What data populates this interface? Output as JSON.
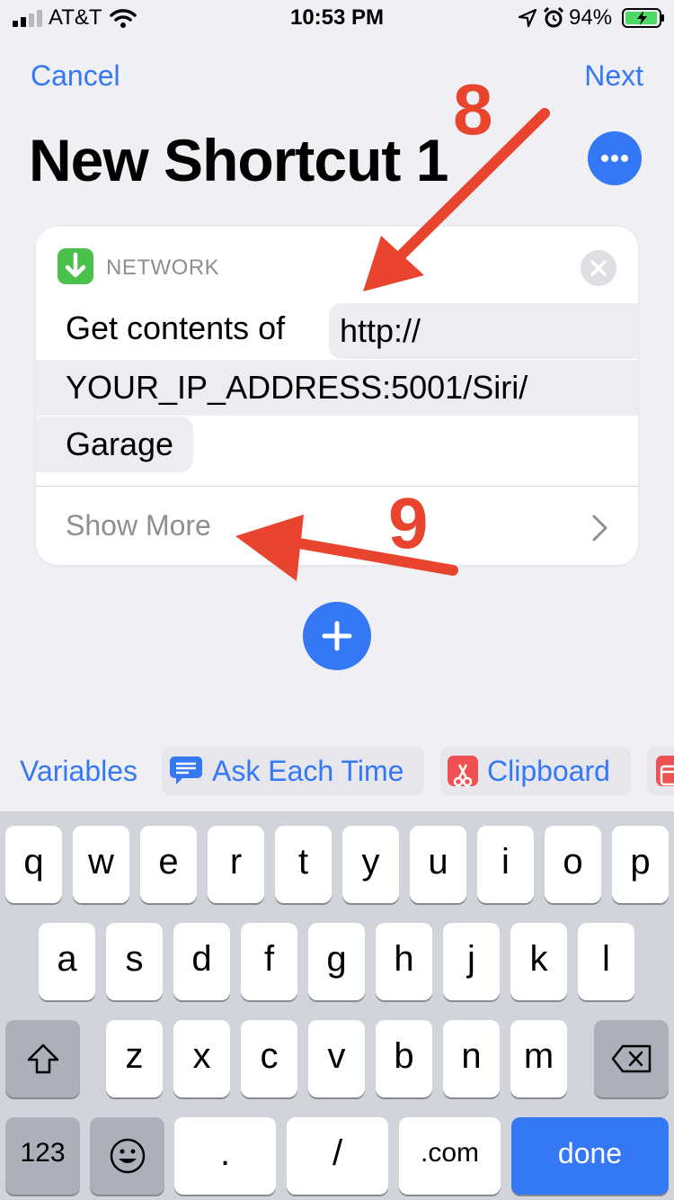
{
  "status_bar": {
    "carrier": "AT&T",
    "time": "10:53 PM",
    "battery": "94%"
  },
  "nav": {
    "cancel": "Cancel",
    "next": "Next",
    "title": "New Shortcut 1"
  },
  "action": {
    "category": "NETWORK",
    "label": "Get contents of",
    "url_line1": "http://",
    "url_line2": "YOUR_IP_ADDRESS:5001/Siri/",
    "url_line3": "Garage",
    "show_more": "Show More"
  },
  "annotations": {
    "step_a": "8",
    "step_b": "9"
  },
  "suggestions": {
    "variables": "Variables",
    "ask_each_time": "Ask Each Time",
    "clipboard": "Clipboard"
  },
  "keyboard": {
    "row1": [
      "q",
      "w",
      "e",
      "r",
      "t",
      "y",
      "u",
      "i",
      "o",
      "p"
    ],
    "row2": [
      "a",
      "s",
      "d",
      "f",
      "g",
      "h",
      "j",
      "k",
      "l"
    ],
    "row3": [
      "z",
      "x",
      "c",
      "v",
      "b",
      "n",
      "m"
    ],
    "numbers": "123",
    "period": ".",
    "slash": "/",
    "dotcom": ".com",
    "done": "done"
  },
  "colors": {
    "accent": "#3478f6",
    "annotation": "#e8442e",
    "network_icon": "#4bc14b"
  },
  "icons": [
    "signal-icon",
    "wifi-icon",
    "location-icon",
    "alarm-icon",
    "battery-icon",
    "ellipsis-icon",
    "download-arrow-icon",
    "close-icon",
    "chevron-right-icon",
    "plus-icon",
    "message-icon",
    "scissors-icon",
    "calendar-icon",
    "shift-icon",
    "backspace-icon",
    "emoji-icon"
  ]
}
